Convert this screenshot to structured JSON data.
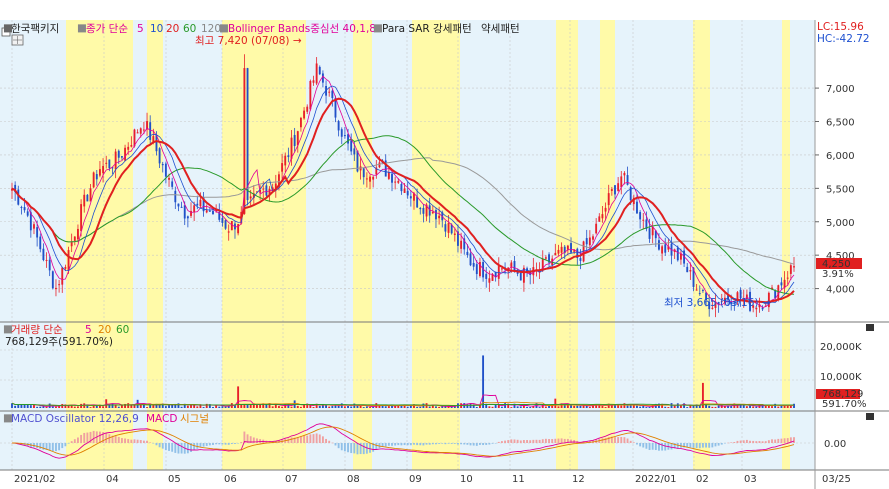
{
  "header": {
    "stock_name": "한국팩키지",
    "ma_label": "종가 단순",
    "ma_periods": [
      "5",
      "10",
      "20",
      "60",
      "120"
    ],
    "ma_colors": [
      "#e0009a",
      "#1e50d0",
      "#e02020",
      "#2a9a2a",
      "#888888"
    ],
    "bollinger_label": "Bollinger Bands중심선 40,1,8",
    "parasar_label": "Para SAR 강세패턴",
    "weak_label": "약세패턴",
    "lc_label": "LC:15.96",
    "hc_label": "HC:-42.72"
  },
  "annotations": {
    "high_label": "최고 7,420 (07/08) →",
    "low_label": "최저 3,665 (03/16) →"
  },
  "price_axis": {
    "ticks": [
      "7,000",
      "6,500",
      "6,000",
      "5,500",
      "5,000",
      "4,500",
      "4,000"
    ],
    "current_price": "4,250",
    "current_change": "3.91%"
  },
  "volume_panel": {
    "title": "거래량 단순",
    "periods": [
      "5",
      "20",
      "60"
    ],
    "period_colors": [
      "#e0009a",
      "#e08000",
      "#2a9a2a"
    ],
    "summary": "768,129주(591.70%)",
    "ticks": [
      "20,000K",
      "10,000K"
    ],
    "current_volume": "768,129",
    "current_ratio": "591.70%"
  },
  "macd_panel": {
    "oscillator_label": "MACD Oscillator 12,26,9",
    "macd_label": "MACD",
    "signal_label": "시그널",
    "zero_tick": "0.00"
  },
  "time_axis": {
    "labels": [
      "2021/02",
      "04",
      "05",
      "06",
      "07",
      "08",
      "09",
      "10",
      "11",
      "12",
      "2022/01",
      "02",
      "03"
    ],
    "end_label": "03/25"
  },
  "colors": {
    "up": "#e8202a",
    "down": "#2050c8",
    "blue_band": "#e6f3fb",
    "yellow_band": "#fffaa8",
    "grid": "#c8c8c8"
  },
  "chart_data": {
    "type": "candlestick",
    "x_range": [
      "2021/02",
      "03/25"
    ],
    "y_range": [
      3500,
      7600
    ],
    "high": {
      "value": 7420,
      "date": "07/08"
    },
    "low": {
      "value": 3665,
      "date": "03/16"
    },
    "last_close": 4250,
    "last_change_percent": 3.91,
    "approx_closes": [
      {
        "date": "2021/02",
        "value": 5500
      },
      {
        "date": "03",
        "value": 4100
      },
      {
        "date": "04",
        "value": 5800
      },
      {
        "date": "04-mid",
        "value": 6400
      },
      {
        "date": "05",
        "value": 5200
      },
      {
        "date": "06",
        "value": 5000
      },
      {
        "date": "07",
        "value": 5500
      },
      {
        "date": "07/08",
        "value": 7200
      },
      {
        "date": "08",
        "value": 5800
      },
      {
        "date": "08-mid",
        "value": 5600
      },
      {
        "date": "09",
        "value": 4900
      },
      {
        "date": "10",
        "value": 4200
      },
      {
        "date": "11",
        "value": 4300
      },
      {
        "date": "12",
        "value": 4500
      },
      {
        "date": "12-mid",
        "value": 5600
      },
      {
        "date": "2022/01",
        "value": 4600
      },
      {
        "date": "02",
        "value": 3900
      },
      {
        "date": "03",
        "value": 3750
      },
      {
        "date": "03/25",
        "value": 4250
      }
    ],
    "volume_ylim_k": [
      0,
      25000
    ],
    "macd_zero": 0.0
  }
}
